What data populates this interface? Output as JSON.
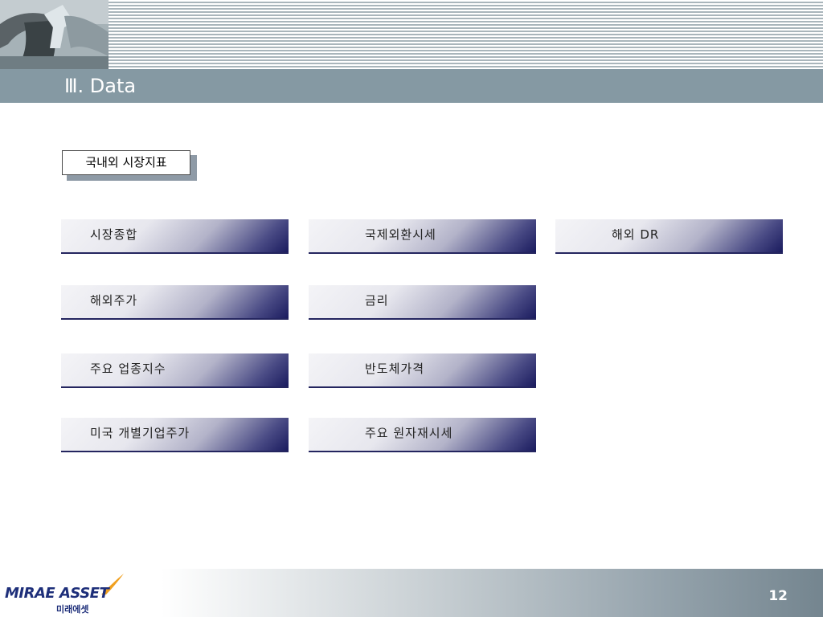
{
  "header": {
    "title": "Ⅲ. Data"
  },
  "section": {
    "label": "국내외 시장지표"
  },
  "nav": {
    "market_summary": "시장종합",
    "intl_fx": "국제외환시세",
    "overseas_dr": "해외 DR",
    "overseas_stocks": "해외주가",
    "interest_rates": "금리",
    "major_sector_index": "주요 업종지수",
    "semiconductor_prices": "반도체가격",
    "us_individual_stocks": "미국 개별기업주가",
    "major_commodities": "주요 원자재시세"
  },
  "footer": {
    "logo_text": "MIRAE ASSET",
    "logo_sub": "미래에셋",
    "page_number": "12"
  }
}
